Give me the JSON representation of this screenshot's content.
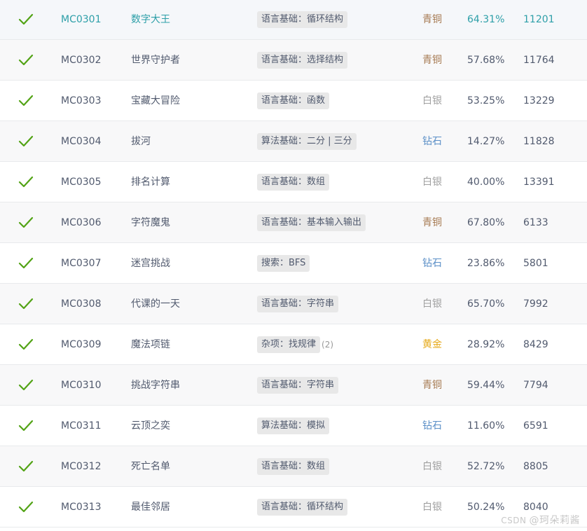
{
  "colors": {
    "check": "#52a315",
    "link": "#2d9fa8",
    "青铜": "#a67a52",
    "白银": "#a0a0a0",
    "钻石": "#5b8fc7",
    "黄金": "#e6a817"
  },
  "check_icon": "checkmark-icon",
  "rows": [
    {
      "id": "MC0301",
      "title": "数字大王",
      "tag": "语言基础：循环结构",
      "tag_extra": "",
      "level": "青铜",
      "rate": "64.31%",
      "count": "11201",
      "active": true
    },
    {
      "id": "MC0302",
      "title": "世界守护者",
      "tag": "语言基础：选择结构",
      "tag_extra": "",
      "level": "青铜",
      "rate": "57.68%",
      "count": "11764"
    },
    {
      "id": "MC0303",
      "title": "宝藏大冒险",
      "tag": "语言基础：函数",
      "tag_extra": "",
      "level": "白银",
      "rate": "53.25%",
      "count": "13229"
    },
    {
      "id": "MC0304",
      "title": "拔河",
      "tag": "算法基础：二分 | 三分",
      "tag_extra": "",
      "level": "钻石",
      "rate": "14.27%",
      "count": "11828"
    },
    {
      "id": "MC0305",
      "title": "排名计算",
      "tag": "语言基础：数组",
      "tag_extra": "",
      "level": "白银",
      "rate": "40.00%",
      "count": "13391"
    },
    {
      "id": "MC0306",
      "title": "字符魔鬼",
      "tag": "语言基础：基本输入输出",
      "tag_extra": "",
      "level": "青铜",
      "rate": "67.80%",
      "count": "6133"
    },
    {
      "id": "MC0307",
      "title": "迷宫挑战",
      "tag": "搜索：BFS",
      "tag_extra": "",
      "level": "钻石",
      "rate": "23.86%",
      "count": "5801"
    },
    {
      "id": "MC0308",
      "title": "代课的一天",
      "tag": "语言基础：字符串",
      "tag_extra": "",
      "level": "白银",
      "rate": "65.70%",
      "count": "7992"
    },
    {
      "id": "MC0309",
      "title": "魔法项链",
      "tag": "杂项：找规律",
      "tag_extra": "(2)",
      "level": "黄金",
      "rate": "28.92%",
      "count": "8429"
    },
    {
      "id": "MC0310",
      "title": "挑战字符串",
      "tag": "语言基础：字符串",
      "tag_extra": "",
      "level": "青铜",
      "rate": "59.44%",
      "count": "7794"
    },
    {
      "id": "MC0311",
      "title": "云顶之奕",
      "tag": "算法基础：模拟",
      "tag_extra": "",
      "level": "钻石",
      "rate": "11.60%",
      "count": "6591"
    },
    {
      "id": "MC0312",
      "title": "死亡名单",
      "tag": "语言基础：数组",
      "tag_extra": "",
      "level": "白银",
      "rate": "52.72%",
      "count": "8805"
    },
    {
      "id": "MC0313",
      "title": "最佳邻居",
      "tag": "语言基础：循环结构",
      "tag_extra": "",
      "level": "白银",
      "rate": "50.24%",
      "count": "8040"
    }
  ],
  "watermark": {
    "brand": "CSDN",
    "author": "@珂朵莉酱"
  }
}
